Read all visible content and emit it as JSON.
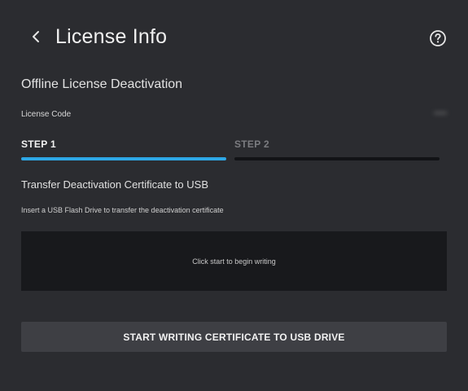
{
  "header": {
    "title": "License Info",
    "back_icon": "chevron-left-icon",
    "help_icon": "question-circle-icon"
  },
  "section": {
    "title": "Offline License Deactivation"
  },
  "license": {
    "label": "License Code",
    "value": "•••••"
  },
  "steps": [
    {
      "label": "STEP 1",
      "active": true
    },
    {
      "label": "STEP 2",
      "active": false
    }
  ],
  "transfer": {
    "title": "Transfer Deactivation Certificate to USB",
    "description": "Insert a USB Flash Drive to transfer the deactivation certificate"
  },
  "status": {
    "message": "Click start to begin writing"
  },
  "action": {
    "start_label": "START WRITING CERTIFICATE TO USB DRIVE"
  },
  "colors": {
    "background": "#2b2c30",
    "accent": "#2ea8e6",
    "panel": "#18191c",
    "button": "#3e3f44"
  }
}
